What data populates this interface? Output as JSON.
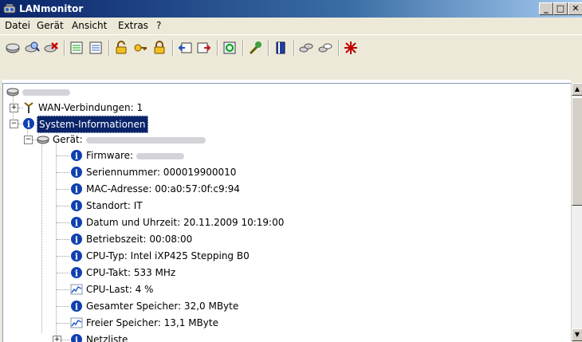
{
  "window": {
    "title": "LANmonitor"
  },
  "menu": [
    "Datei",
    "Gerät",
    "Ansicht",
    "Extras",
    "?"
  ],
  "toolbar": {
    "icons": [
      "device-icon",
      "find-device-icon",
      "delete-device-icon",
      "list-icon",
      "list-icon",
      "unlock-icon",
      "key-icon",
      "lock-icon",
      "back-icon",
      "forward-icon",
      "refresh-icon",
      "wand-icon",
      "book-icon",
      "network-icon",
      "network-icon",
      "close-icon"
    ]
  },
  "tree": {
    "root_label": "",
    "wan": "WAN-Verbindungen: 1",
    "sysinfo": "System-Informationen",
    "geraet": "Gerät:",
    "firmware": "Firmware:",
    "seriennummer": "Seriennummer: 000019900010",
    "mac": "MAC-Adresse: 00:a0:57:0f:c9:94",
    "standort": "Standort: IT",
    "datum": "Datum und Uhrzeit: 20.11.2009 10:19:00",
    "betriebszeit": "Betriebszeit: 00:08:00",
    "cputyp": "CPU-Typ: Intel iXP425 Stepping B0",
    "cputakt": "CPU-Takt: 533 MHz",
    "cpulast": "CPU-Last: 4 %",
    "speicher": "Gesamter Speicher: 32,0 MByte",
    "freier": "Freier Speicher: 13,1 MByte",
    "netzliste": "Netzliste"
  }
}
